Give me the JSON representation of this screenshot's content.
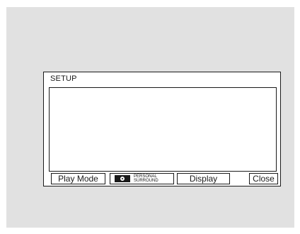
{
  "dialog": {
    "title": "SETUP",
    "buttons": {
      "play_mode": "Play Mode",
      "personal_surround_line1": "PERSONAL",
      "personal_surround_line2": "SURROUND",
      "display": "Display",
      "close": "Close"
    }
  },
  "icons": {
    "personal_surround": "personal-surround-icon"
  },
  "colors": {
    "background": "#e1e1e1",
    "dialog": "#ffffff",
    "border": "#1a1a1a"
  }
}
